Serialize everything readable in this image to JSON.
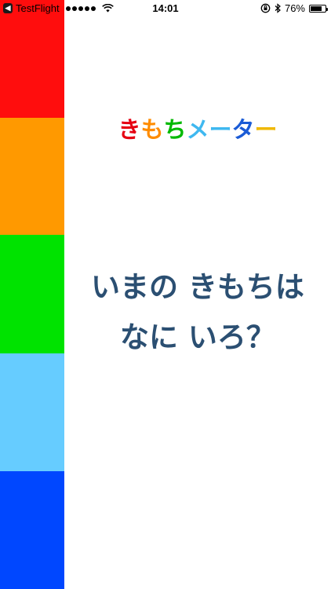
{
  "status_bar": {
    "back_app": "TestFlight",
    "back_badge": "◀",
    "time": "14:01",
    "battery_text": "76%",
    "battery_level": 0.76
  },
  "color_strip": [
    {
      "name": "red",
      "color": "#ff0d0d"
    },
    {
      "name": "orange",
      "color": "#ff9900"
    },
    {
      "name": "green",
      "color": "#00e300"
    },
    {
      "name": "light-blue",
      "color": "#66ccff"
    },
    {
      "name": "blue",
      "color": "#0047ff"
    }
  ],
  "logo": {
    "chars": [
      {
        "text": "き",
        "color": "#e60012"
      },
      {
        "text": "も",
        "color": "#ff8c00"
      },
      {
        "text": "ち",
        "color": "#00b900"
      },
      {
        "text": "メ",
        "color": "#3fb8f0"
      },
      {
        "text": "ー",
        "color": "#3fb8f0"
      },
      {
        "text": "タ",
        "color": "#1a5bd6"
      },
      {
        "text": "ー",
        "color": "#f0b800"
      }
    ]
  },
  "question": {
    "line1": "いまの きもちは",
    "line2": "なに いろ？"
  }
}
